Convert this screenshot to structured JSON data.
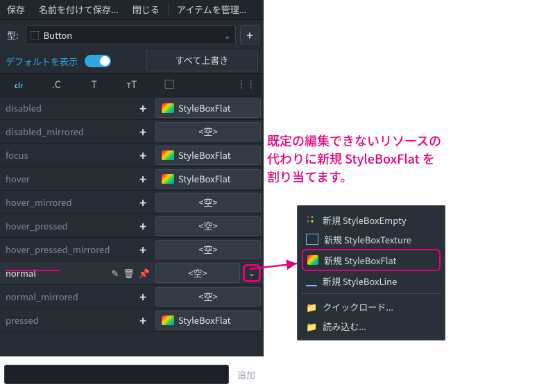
{
  "toolbar": {
    "save": "保存",
    "save_as": "名前を付けて保存...",
    "close": "閉じる",
    "manage": "アイテムを管理..."
  },
  "type_row": {
    "label": "型:",
    "value": "Button",
    "add": "+"
  },
  "defaults": {
    "link": "デフォルトを表示",
    "override_all": "すべて上書き"
  },
  "icons": {
    "clr": "clr",
    "const": ".C",
    "font": "T",
    "fontsize": "ᴛT",
    "image": "▢",
    "style": "▦",
    "misc": "┆┆"
  },
  "styleboxflat": "StyleBoxFlat",
  "empty_label": "<空>",
  "props": [
    {
      "name": "disabled",
      "value": "flat"
    },
    {
      "name": "disabled_mirrored",
      "value": "empty"
    },
    {
      "name": "focus",
      "value": "flat"
    },
    {
      "name": "hover",
      "value": "flat"
    },
    {
      "name": "hover_mirrored",
      "value": "empty"
    },
    {
      "name": "hover_pressed",
      "value": "empty"
    },
    {
      "name": "hover_pressed_mirrored",
      "value": "empty"
    },
    {
      "name": "normal",
      "value": "empty",
      "active": true
    },
    {
      "name": "normal_mirrored",
      "value": "empty"
    },
    {
      "name": "pressed",
      "value": "flat"
    }
  ],
  "bottom": {
    "add": "追加"
  },
  "annotation": {
    "l1": "既定の編集できないリソースの",
    "l2": "代わりに新規 StyleBoxFlat を",
    "l3": "割り当てます。"
  },
  "popup": {
    "items": [
      {
        "label": "新規 StyleBoxEmpty",
        "icon": "dots"
      },
      {
        "label": "新規 StyleBoxTexture",
        "icon": "img"
      },
      {
        "label": "新規 StyleBoxFlat",
        "icon": "grad",
        "selected": true
      },
      {
        "label": "新規 StyleBoxLine",
        "icon": "line"
      }
    ],
    "quickload": "クイックロード...",
    "load": "読み込む..."
  }
}
